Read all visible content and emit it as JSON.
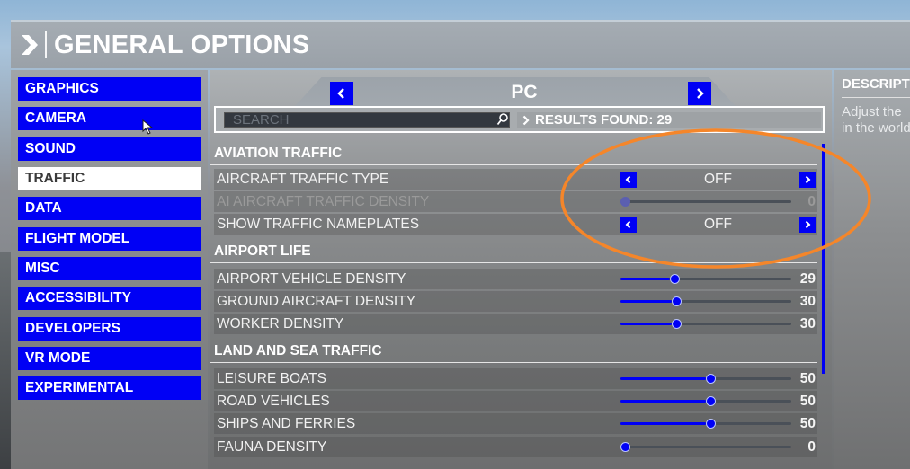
{
  "window": {
    "title": "GENERAL OPTIONS"
  },
  "sidebar": {
    "items": [
      {
        "label": "GRAPHICS",
        "active": false
      },
      {
        "label": "CAMERA",
        "active": false
      },
      {
        "label": "SOUND",
        "active": false
      },
      {
        "label": "TRAFFIC",
        "active": true
      },
      {
        "label": "DATA",
        "active": false
      },
      {
        "label": "FLIGHT MODEL",
        "active": false
      },
      {
        "label": "MISC",
        "active": false
      },
      {
        "label": "ACCESSIBILITY",
        "active": false
      },
      {
        "label": "DEVELOPERS",
        "active": false
      },
      {
        "label": "VR MODE",
        "active": false
      },
      {
        "label": "EXPERIMENTAL",
        "active": false
      }
    ]
  },
  "platform": {
    "label": "PC",
    "prev_icon": "chevron-left-icon",
    "next_icon": "chevron-right-icon"
  },
  "search": {
    "placeholder": "SEARCH",
    "value": "",
    "results_label": "RESULTS FOUND: 29"
  },
  "sections": [
    {
      "title": "AVIATION TRAFFIC",
      "rows": [
        {
          "label": "AIRCRAFT TRAFFIC TYPE",
          "type": "toggle",
          "value": "OFF",
          "disabled": false
        },
        {
          "label": "AI AIRCRAFT TRAFFIC DENSITY",
          "type": "slider",
          "value": 0,
          "max": 100,
          "disabled": true
        },
        {
          "label": "SHOW TRAFFIC NAMEPLATES",
          "type": "toggle",
          "value": "OFF",
          "disabled": false
        }
      ]
    },
    {
      "title": "AIRPORT LIFE",
      "rows": [
        {
          "label": "AIRPORT VEHICLE DENSITY",
          "type": "slider",
          "value": 29,
          "max": 100,
          "disabled": false
        },
        {
          "label": "GROUND AIRCRAFT DENSITY",
          "type": "slider",
          "value": 30,
          "max": 100,
          "disabled": false
        },
        {
          "label": "WORKER DENSITY",
          "type": "slider",
          "value": 30,
          "max": 100,
          "disabled": false
        }
      ]
    },
    {
      "title": "LAND AND SEA TRAFFIC",
      "rows": [
        {
          "label": "LEISURE BOATS",
          "type": "slider",
          "value": 50,
          "max": 100,
          "disabled": false
        },
        {
          "label": "ROAD VEHICLES",
          "type": "slider",
          "value": 50,
          "max": 100,
          "disabled": false
        },
        {
          "label": "SHIPS AND FERRIES",
          "type": "slider",
          "value": 50,
          "max": 100,
          "disabled": false
        },
        {
          "label": "FAUNA DENSITY",
          "type": "slider",
          "value": 0,
          "max": 100,
          "disabled": false
        }
      ]
    }
  ],
  "description": {
    "title": "DESCRIPTION",
    "text_lines": [
      "Adjust the",
      "in the world"
    ]
  },
  "colors": {
    "accent": "#0000f5",
    "annotation": "#f5862a",
    "active_tab_bg": "#ffffff"
  }
}
